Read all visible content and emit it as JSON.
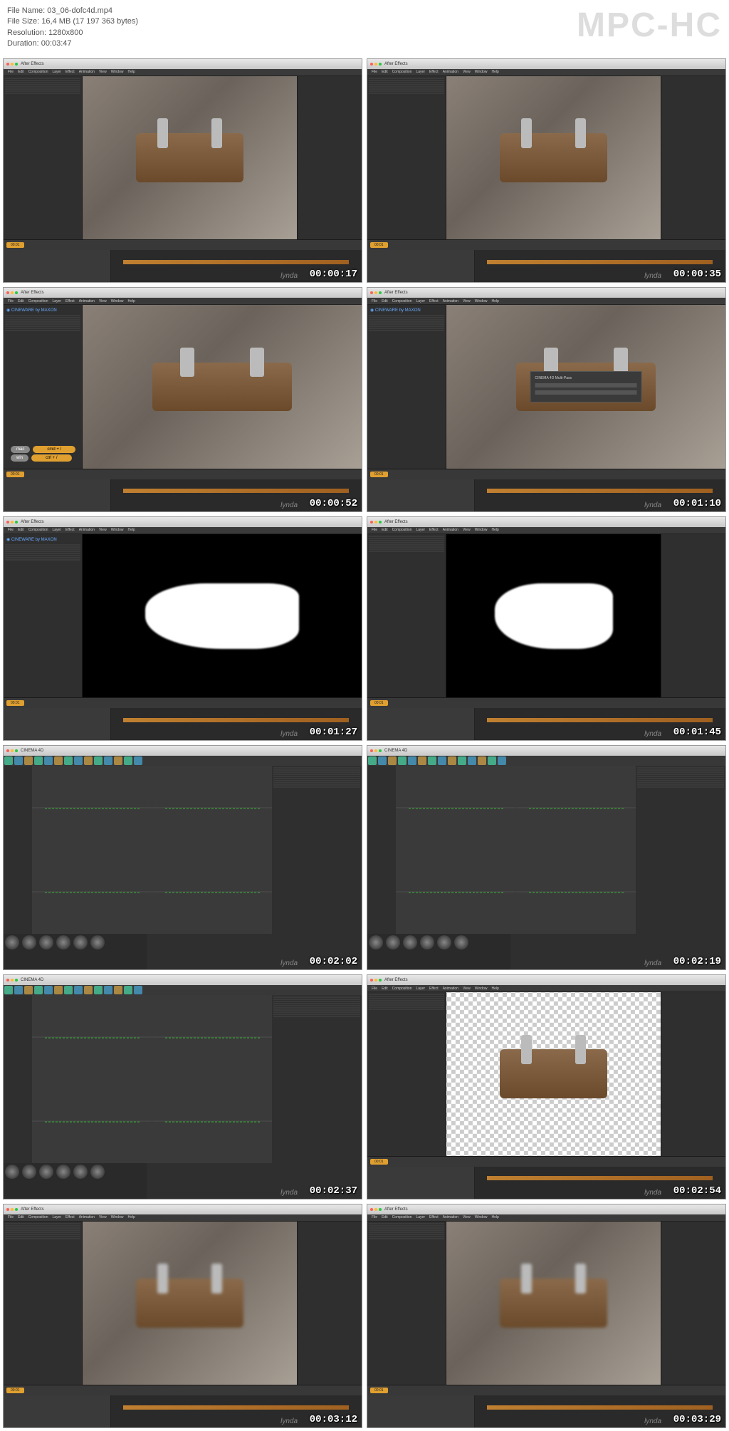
{
  "header": {
    "file_name_label": "File Name:",
    "file_name": "03_06-dofc4d.mp4",
    "file_size_label": "File Size:",
    "file_size": "16,4 MB (17 197 363 bytes)",
    "resolution_label": "Resolution:",
    "resolution": "1280x800",
    "duration_label": "Duration:",
    "duration": "00:03:47",
    "watermark": "MPC-HC"
  },
  "app": {
    "name": "After Effects",
    "menu": [
      "File",
      "Edit",
      "Composition",
      "Layer",
      "Effect",
      "Animation",
      "View",
      "Window",
      "Help"
    ],
    "c4d_name": "CINEMA 4D",
    "lynda": "lynda"
  },
  "cineware": {
    "label": "CINEWARE by MAXON",
    "dialog_title": "CINEMA 4D Multi-Pass"
  },
  "shortcuts": {
    "mac_label": "mac",
    "mac_key": "cmd + /",
    "win_label": "win",
    "win_key": "ctrl + /"
  },
  "timeline_tag": "00:01",
  "thumbs": [
    {
      "ts": "00:00:17",
      "type": "ae-skate"
    },
    {
      "ts": "00:00:35",
      "type": "ae-skate"
    },
    {
      "ts": "00:00:52",
      "type": "ae-cineware-shortcut"
    },
    {
      "ts": "00:01:10",
      "type": "ae-dialog"
    },
    {
      "ts": "00:01:27",
      "type": "ae-depth"
    },
    {
      "ts": "00:01:45",
      "type": "ae-depth-panel"
    },
    {
      "ts": "00:02:02",
      "type": "c4d"
    },
    {
      "ts": "00:02:19",
      "type": "c4d"
    },
    {
      "ts": "00:02:37",
      "type": "c4d"
    },
    {
      "ts": "00:02:54",
      "type": "ae-checker"
    },
    {
      "ts": "00:03:12",
      "type": "ae-skate-blur"
    },
    {
      "ts": "00:03:29",
      "type": "ae-skate-blur"
    }
  ]
}
